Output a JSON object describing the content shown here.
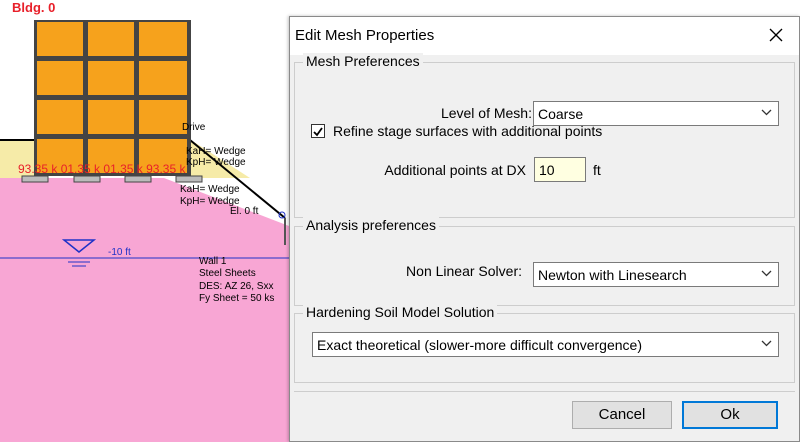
{
  "scene": {
    "building_label": "Bldg. 0",
    "load_labels": "93.35 k 01.35 k 01.35 k 93.35 k",
    "labels": {
      "drive": "Drive",
      "kah1": "KaH= Wedge",
      "kph1": "KpH= Wedge",
      "kah2": "KaH= Wedge",
      "kph2": "KpH= Wedge",
      "elev": "El. 0 ft",
      "water": "-10 ft",
      "wall1": "Wall 1",
      "wall2": "Steel Sheets",
      "wall3": "DES: AZ 26, Sxx",
      "wall4": "Fy Sheet = 50 ks"
    },
    "colors": {
      "soil": "#f8a6d4",
      "sand": "#f6eba8",
      "building": "#f6a21c",
      "water_line": "#1f32c8",
      "load_text": "#e8202a"
    }
  },
  "dialog": {
    "title": "Edit Mesh Properties",
    "mesh_prefs": {
      "group_label": "Mesh Preferences",
      "level_label": "Level of Mesh:",
      "level_value": "Coarse",
      "refine_label": "Refine stage surfaces with additional points",
      "refine_checked": true,
      "dx_label": "Additional points at DX",
      "dx_value": "10",
      "dx_unit": "ft"
    },
    "analysis_prefs": {
      "group_label": "Analysis preferences",
      "solver_label": "Non Linear Solver:",
      "solver_value": "Newton with Linesearch"
    },
    "hardening": {
      "group_label": "Hardening Soil Model Solution",
      "value": "Exact theoretical (slower-more difficult convergence)"
    },
    "buttons": {
      "cancel": "Cancel",
      "ok": "Ok"
    }
  }
}
